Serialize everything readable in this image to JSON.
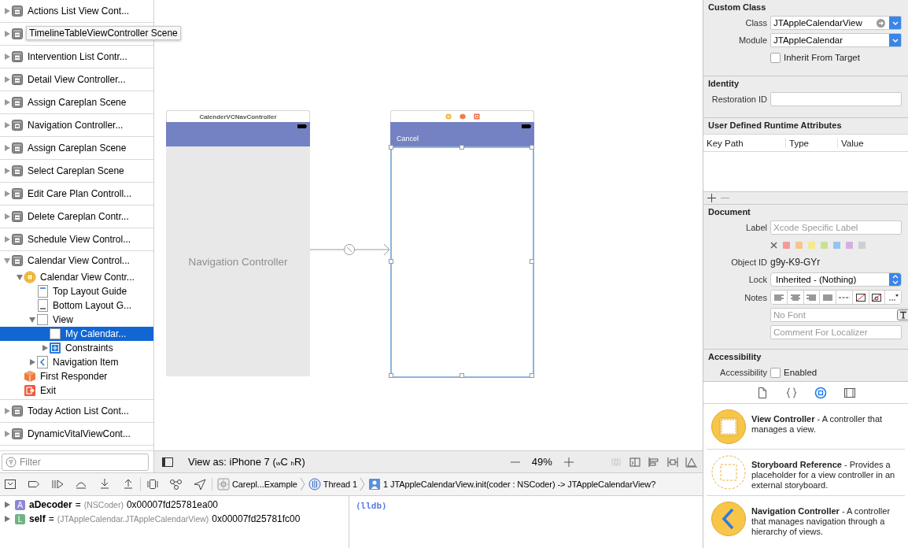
{
  "outline": {
    "scenes": [
      {
        "kind": "scene",
        "label": "Actions List View Cont...",
        "expanded": false,
        "selected": false
      },
      {
        "kind": "scene",
        "tooltip": "TimelineTableViewController Scene",
        "expanded": false,
        "selected": false
      },
      {
        "kind": "scene",
        "label": "Intervention List Contr...",
        "expanded": false,
        "selected": false
      },
      {
        "kind": "scene",
        "label": "Detail View Controller...",
        "expanded": false,
        "selected": false
      },
      {
        "kind": "scene",
        "label": "Assign Careplan Scene",
        "expanded": false,
        "selected": false
      },
      {
        "kind": "nav-scene",
        "label": "Navigation Controller...",
        "expanded": false,
        "selected": false
      },
      {
        "kind": "scene",
        "label": "Assign Careplan Scene",
        "expanded": false,
        "selected": false
      },
      {
        "kind": "scene",
        "label": "Select Careplan Scene",
        "expanded": false,
        "selected": false
      },
      {
        "kind": "scene",
        "label": "Edit Care Plan Controll...",
        "expanded": false,
        "selected": false
      },
      {
        "kind": "scene",
        "label": "Delete Careplan Contr...",
        "expanded": false,
        "selected": false
      },
      {
        "kind": "scene",
        "label": "Schedule View Control...",
        "expanded": false,
        "selected": false
      },
      {
        "kind": "scene",
        "label": "Calendar View Control...",
        "expanded": true,
        "selected": false,
        "children": [
          {
            "kind": "controller",
            "label": "Calendar View Contr...",
            "expanded": true,
            "selected": false,
            "children": [
              {
                "kind": "top-guide",
                "label": "Top Layout Guide",
                "selected": false
              },
              {
                "kind": "bottom-guide",
                "label": "Bottom Layout G...",
                "selected": false
              },
              {
                "kind": "view",
                "label": "View",
                "expanded": true,
                "selected": false,
                "children": [
                  {
                    "kind": "view",
                    "label": "My Calendar...",
                    "selected": true
                  },
                  {
                    "kind": "constraints",
                    "label": "Constraints",
                    "expanded": false,
                    "selected": false
                  }
                ]
              },
              {
                "kind": "nav-item",
                "label": "Navigation Item",
                "expanded": false,
                "selected": false
              }
            ]
          },
          {
            "kind": "responder",
            "label": "First Responder",
            "selected": false
          },
          {
            "kind": "exit",
            "label": "Exit",
            "selected": false
          }
        ]
      },
      {
        "kind": "scene",
        "label": "Today Action List Cont...",
        "expanded": false,
        "selected": false
      },
      {
        "kind": "scene",
        "label": "DynamicVitalViewCont...",
        "expanded": false,
        "selected": false
      }
    ],
    "filter": {
      "placeholder": "Filter"
    }
  },
  "canvas": {
    "scenes": [
      {
        "kind": "navigation",
        "title": "CalenderVCNavController",
        "body_label": "Navigation Controller",
        "selected": false
      },
      {
        "kind": "view-controller",
        "bar_button": "Cancel",
        "selected": true
      }
    ]
  },
  "canvas_toolbar": {
    "view_as": "View as: iPhone 7 ($_{w}$C $_{h}$R)",
    "zoom": "49%"
  },
  "debug_bar": {
    "breadcrumbs": [
      {
        "kind": "app",
        "label": "Carepl...Example"
      },
      {
        "kind": "thread",
        "label": "Thread 1"
      },
      {
        "kind": "frame",
        "label": "1 JTAppleCalendarView.init(coder : NSCoder) -> JTAppleCalendarView?"
      }
    ]
  },
  "variables": [
    {
      "kind": "argument",
      "badge": "A",
      "name": "aDecoder",
      "sign": "=",
      "type": "(NSCoder)",
      "value": "0x00007fd25781ea00",
      "expanded": false
    },
    {
      "kind": "local",
      "badge": "L",
      "name": "self",
      "sign": "=",
      "type": "(JTAppleCalendar.JTAppleCalendarView)",
      "value": "0x00007fd25781fc00",
      "expanded": false
    }
  ],
  "console": {
    "prompt": "(lldb)"
  },
  "inspector": {
    "custom_class": {
      "title": "Custom Class",
      "class_label": "Class",
      "class_value": "JTAppleCalendarView",
      "module_label": "Module",
      "module_value": "JTAppleCalendar",
      "inherit": {
        "label": "Inherit From Target",
        "checked": false
      }
    },
    "identity": {
      "title": "Identity",
      "restoration_label": "Restoration ID"
    },
    "runtime_attributes": {
      "title": "User Defined Runtime Attributes",
      "columns": [
        "Key Path",
        "Type",
        "Value"
      ]
    },
    "document": {
      "title": "Document",
      "label_label": "Label",
      "label_placeholder": "Xcode Specific Label",
      "swatches": [
        {
          "color": "#f39a9a"
        },
        {
          "color": "#f7c58a"
        },
        {
          "color": "#f5e98f"
        },
        {
          "color": "#c9e291"
        },
        {
          "color": "#93c5f2"
        },
        {
          "color": "#d6aee3"
        },
        {
          "color": "#cfcfcf"
        }
      ],
      "object_id_label": "Object ID",
      "object_id": "g9y-K9-GYr",
      "lock_label": "Lock",
      "lock_value": "Inherited - (Nothing)",
      "notes_label": "Notes",
      "font_placeholder": "No Font",
      "comment_placeholder": "Comment For Localizer"
    },
    "accessibility": {
      "title": "Accessibility",
      "label": "Accessibility",
      "enabled": {
        "label": "Enabled",
        "checked": false
      }
    }
  },
  "library": {
    "tabs": [
      {
        "kind": "file",
        "selected": false
      },
      {
        "kind": "code",
        "selected": false
      },
      {
        "kind": "object",
        "selected": true
      },
      {
        "kind": "media",
        "selected": false
      }
    ],
    "items": [
      {
        "kind": "view-controller",
        "text": "**View Controller** - A controller that manages a view."
      },
      {
        "kind": "storyboard-reference",
        "text": "**Storyboard Reference** - Provides a placeholder for a view controller in an external storyboard."
      },
      {
        "kind": "navigation-controller",
        "text": "**Navigation Controller** - A controller that manages navigation through a hierarchy of views."
      }
    ]
  }
}
